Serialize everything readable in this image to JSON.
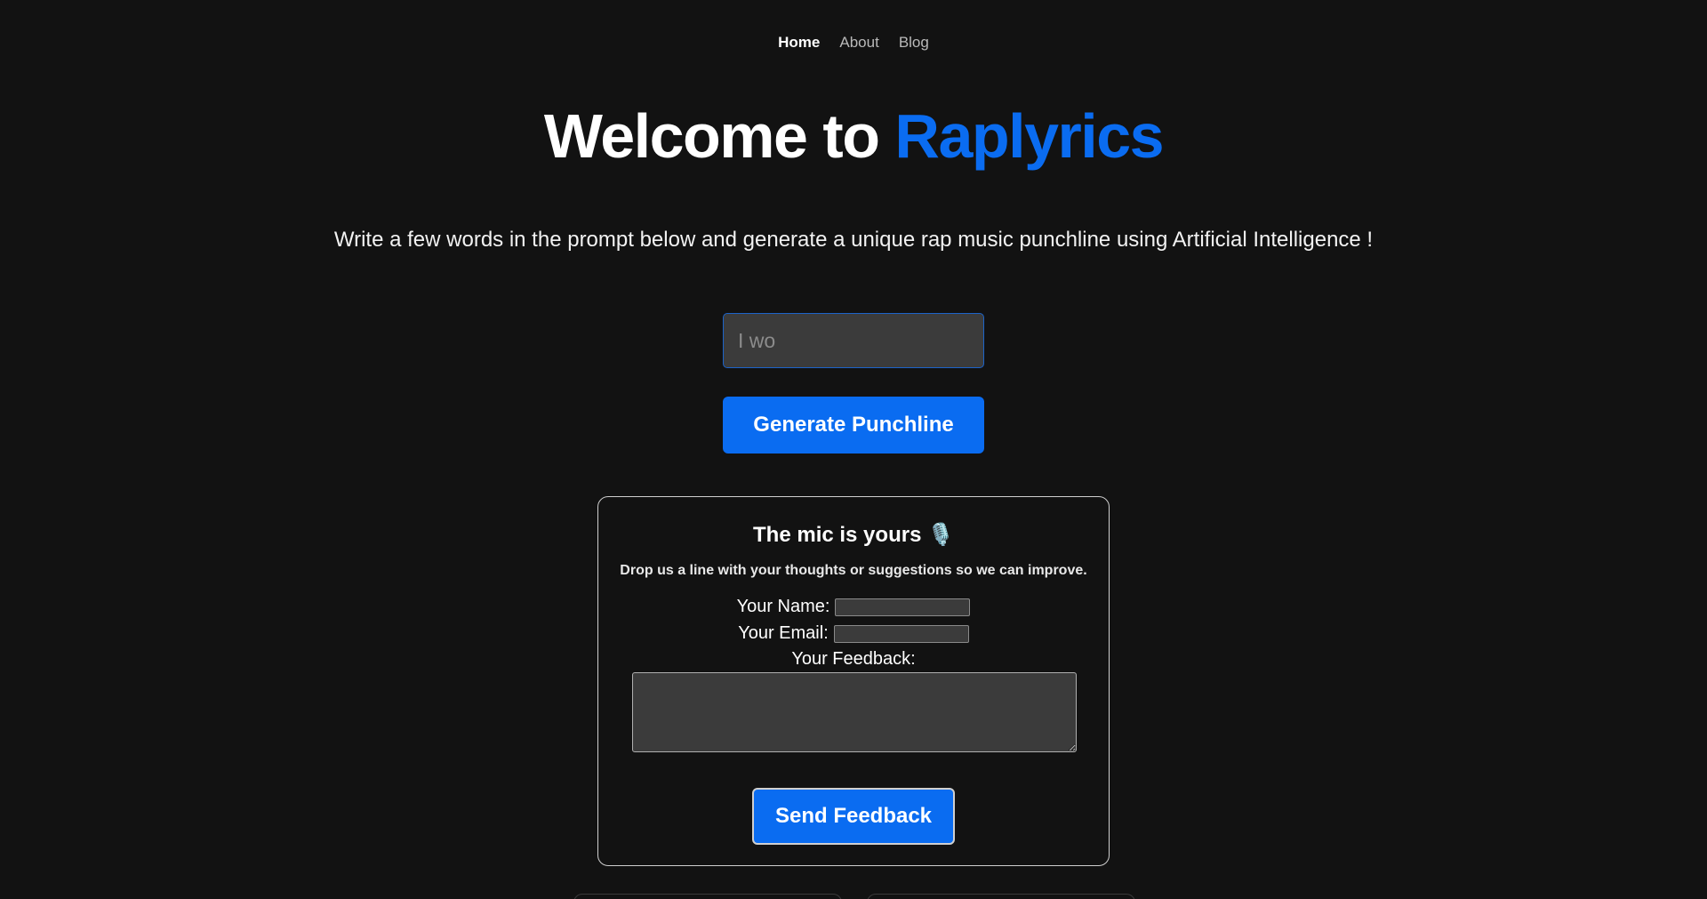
{
  "nav": {
    "items": [
      {
        "label": "Home",
        "active": true
      },
      {
        "label": "About",
        "active": false
      },
      {
        "label": "Blog",
        "active": false
      }
    ]
  },
  "hero": {
    "prefix": "Welcome to ",
    "brand": "Raplyrics",
    "brand_color": "#0a6cf1"
  },
  "subtitle": "Write a few words in the prompt below and generate a unique rap music punchline using Artificial Intelligence !",
  "prompt": {
    "placeholder": "I wo",
    "value": ""
  },
  "generate_button": {
    "label": "Generate Punchline"
  },
  "feedback": {
    "title": "The mic is yours 🎙️",
    "subtitle": "Drop us a line with your thoughts or suggestions so we can improve.",
    "name_label": "Your Name:",
    "email_label": "Your Email:",
    "feedback_label": "Your Feedback:",
    "send_label": "Send Feedback"
  },
  "colors": {
    "background": "#121212",
    "accent": "#0a6cf1",
    "input_bg": "#3b3b3b"
  }
}
